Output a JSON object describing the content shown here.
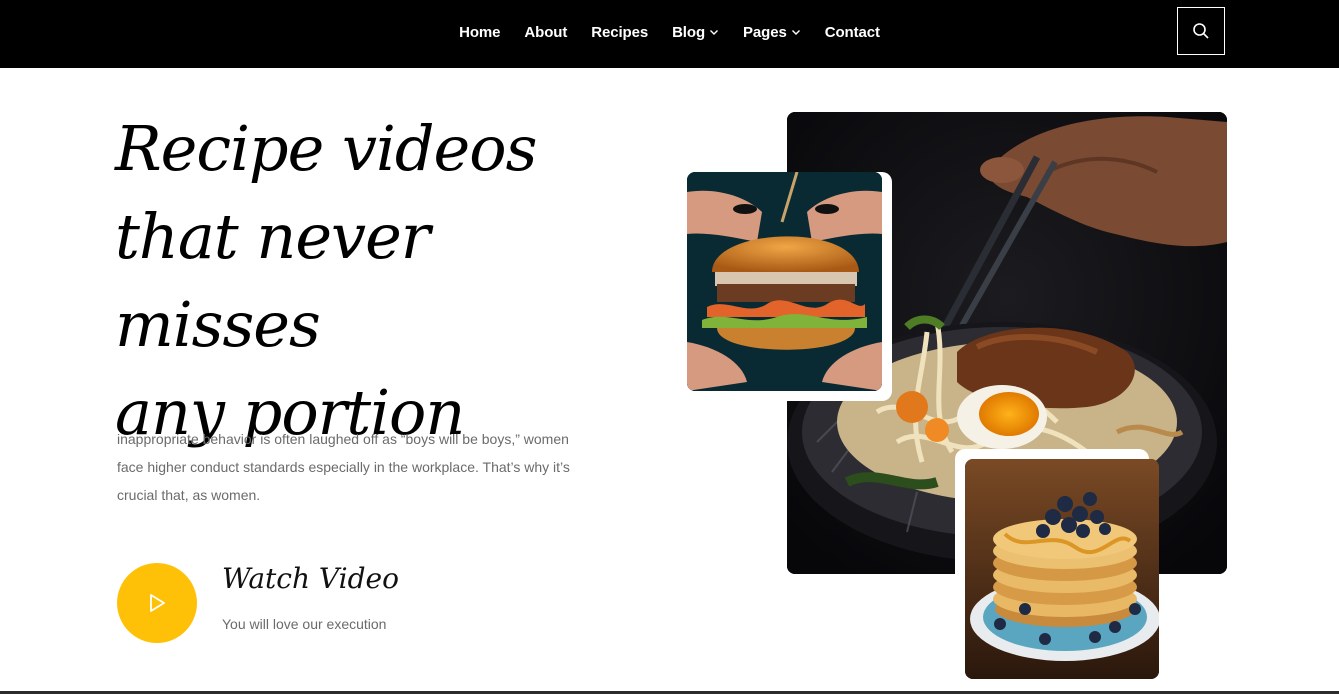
{
  "nav": {
    "items": [
      {
        "label": "Home",
        "has_dropdown": false
      },
      {
        "label": "About",
        "has_dropdown": false
      },
      {
        "label": "Recipes",
        "has_dropdown": false
      },
      {
        "label": "Blog",
        "has_dropdown": true
      },
      {
        "label": "Pages",
        "has_dropdown": true
      },
      {
        "label": "Contact",
        "has_dropdown": false
      }
    ],
    "search_icon": "search-icon"
  },
  "hero": {
    "title_line1": "Recipe videos",
    "title_line2": "that never misses",
    "title_line3": "any portion",
    "description": "inappropriate behavior is often laughed off as “boys will be boys,” women face higher conduct standards especially in the workplace. That’s why it’s crucial that, as women.",
    "watch_title": "Watch Video",
    "watch_subtitle": "You will love our execution"
  },
  "colors": {
    "nav_bg": "#000000",
    "accent": "#ffc107",
    "text_muted": "#6b6b6b"
  }
}
